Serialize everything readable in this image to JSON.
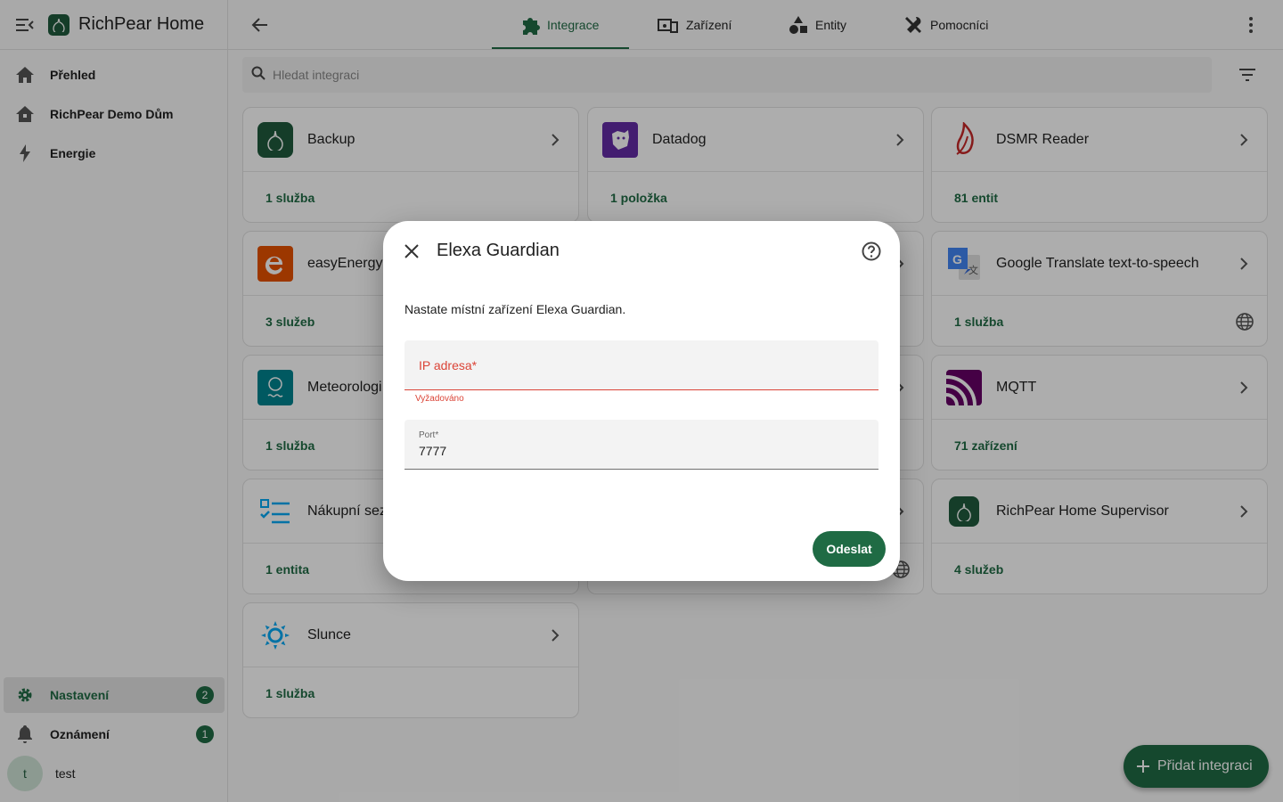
{
  "app": {
    "title": "RichPear Home"
  },
  "sidebar": {
    "items": [
      {
        "label": "Přehled",
        "icon": "home-icon"
      },
      {
        "label": "RichPear Demo Dům",
        "icon": "house-icon"
      },
      {
        "label": "Energie",
        "icon": "lightning-icon"
      }
    ],
    "bottom": [
      {
        "label": "Nastavení",
        "icon": "gear-icon",
        "badge": "2"
      },
      {
        "label": "Oznámení",
        "icon": "bell-icon",
        "badge": "1"
      }
    ],
    "user": {
      "initial": "t",
      "name": "test"
    }
  },
  "tabs": [
    {
      "label": "Integrace",
      "icon": "puzzle-icon"
    },
    {
      "label": "Zařízení",
      "icon": "devices-icon"
    },
    {
      "label": "Entity",
      "icon": "shapes-icon"
    },
    {
      "label": "Pomocníci",
      "icon": "tools-icon"
    }
  ],
  "search": {
    "placeholder": "Hledat integraci"
  },
  "cards": [
    {
      "name": "Backup",
      "footer": "1 služba"
    },
    {
      "name": "Datadog",
      "footer": "1 položka"
    },
    {
      "name": "DSMR Reader",
      "footer": "81 entit"
    },
    {
      "name": "easyEnergy",
      "footer": "3 služeb"
    },
    {
      "name": "Google Translate text-to-speech",
      "footer": "1 služba"
    },
    {
      "name": "Meteorologi",
      "footer": "1 služba"
    },
    {
      "name": "MQTT",
      "footer": "71 zařízení"
    },
    {
      "name": "Nákupní sez",
      "footer": "1 entita"
    },
    {
      "name": "RichPear Home Supervisor",
      "footer": "4 služeb"
    },
    {
      "name": "Slunce",
      "footer": "1 služba"
    }
  ],
  "fab": {
    "label": "Přidat integraci"
  },
  "dialog": {
    "title": "Elexa Guardian",
    "description": "Nastate místní zařízení Elexa Guardian.",
    "ip_label": "IP adresa*",
    "ip_helper": "Vyžadováno",
    "port_label": "Port*",
    "port_value": "7777",
    "submit": "Odeslat"
  },
  "colors": {
    "primary": "#1f6b44",
    "error": "#db4437"
  }
}
